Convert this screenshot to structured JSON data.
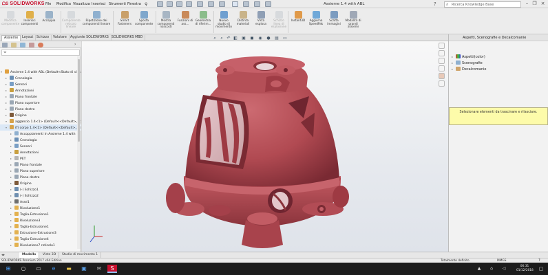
{
  "app": {
    "brand": "SOLIDWORKS",
    "doc_title": "Assieme 1.4 with ABL",
    "search_placeholder": "Ricerca Knowledge Base",
    "menus": [
      "File",
      "Modifica",
      "Visualizza",
      "Inserisci",
      "Strumenti",
      "Finestra"
    ]
  },
  "ribbon": {
    "buttons": [
      {
        "label": "Modifica componente",
        "icon": "edit-component-icon",
        "enabled": false
      },
      {
        "label": "Inserisci componenti",
        "icon": "insert-components-icon",
        "enabled": true
      },
      {
        "label": "Accoppia",
        "icon": "mate-icon",
        "enabled": true
      },
      {
        "label": "Componente reticolo lineare",
        "icon": "linear-pattern-icon",
        "enabled": false
      },
      {
        "label": "Ripetizione dei componenti lineare",
        "icon": "pattern-driven-icon",
        "enabled": true
      },
      {
        "label": "Smart Fasteners",
        "icon": "smart-fasteners-icon",
        "enabled": true
      },
      {
        "label": "Sposta componente",
        "icon": "move-component-icon",
        "enabled": true
      },
      {
        "label": "Mostra componenti nascosti",
        "icon": "show-hidden-icon",
        "enabled": true
      },
      {
        "label": "Funzioni di ass...",
        "icon": "assembly-features-icon",
        "enabled": true
      },
      {
        "label": "Geometria di riferim...",
        "icon": "reference-geometry-icon",
        "enabled": true
      },
      {
        "label": "Nuovo studio di movimento",
        "icon": "motion-study-icon",
        "enabled": true
      },
      {
        "label": "Distinta materiali",
        "icon": "bom-icon",
        "enabled": true
      },
      {
        "label": "Vista esplosa",
        "icon": "exploded-view-icon",
        "enabled": true
      },
      {
        "label": "Schizzo linea di esplosione",
        "icon": "explode-line-icon",
        "enabled": false
      },
      {
        "label": "Instant3D",
        "icon": "instant3d-icon",
        "enabled": true
      },
      {
        "label": "Aggiorna SpeedPak",
        "icon": "speedpak-icon",
        "enabled": true
      },
      {
        "label": "Scatta immagini",
        "icon": "snapshot-icon",
        "enabled": true
      },
      {
        "label": "Modalità di grandi assiemi",
        "icon": "large-assembly-icon",
        "enabled": true
      }
    ]
  },
  "command_tabs": [
    "Assieme",
    "Layout",
    "Schizzo",
    "Valutare",
    "Aggiunte SOLIDWORKS",
    "SOLIDWORKS MBD"
  ],
  "active_command_tab": "Assieme",
  "tree": [
    {
      "label": "Assieme 1.4 with ABL  (Default<Stato di visua",
      "level": 0,
      "icon": "assembly-icon",
      "hl": false
    },
    {
      "label": "Cronologia",
      "level": 1,
      "icon": "history-icon",
      "hl": false
    },
    {
      "label": "Sensori",
      "level": 1,
      "icon": "sensor-icon",
      "hl": false
    },
    {
      "label": "Annotazioni",
      "level": 1,
      "icon": "annotation-icon",
      "hl": false
    },
    {
      "label": "Piano frontale",
      "level": 1,
      "icon": "plane-icon",
      "hl": false
    },
    {
      "label": "Piano superiore",
      "level": 1,
      "icon": "plane-icon",
      "hl": false
    },
    {
      "label": "Piano destro",
      "level": 1,
      "icon": "plane-icon",
      "hl": false
    },
    {
      "label": "Origine",
      "level": 1,
      "icon": "origin-icon",
      "hl": false
    },
    {
      "label": "aggancio 1.4<1> (Default<<Default>_Sta",
      "level": 1,
      "icon": "part-icon",
      "hl": false
    },
    {
      "label": "(f) corpo 1.4<1> (Default<<Default>_Sta",
      "level": 1,
      "icon": "part-icon",
      "hl": true
    },
    {
      "label": "Accoppiamenti in Assieme 1.4 with",
      "level": 2,
      "icon": "mate-folder-icon",
      "hl": false
    },
    {
      "label": "Cronologia",
      "level": 2,
      "icon": "history-icon",
      "hl": false
    },
    {
      "label": "Sensori",
      "level": 2,
      "icon": "sensor-icon",
      "hl": false
    },
    {
      "label": "Annotazioni",
      "level": 2,
      "icon": "annotation-icon",
      "hl": false
    },
    {
      "label": "PET",
      "level": 2,
      "icon": "material-icon",
      "hl": false
    },
    {
      "label": "Piano frontale",
      "level": 2,
      "icon": "plane-icon",
      "hl": false
    },
    {
      "label": "Piano superiore",
      "level": 2,
      "icon": "plane-icon",
      "hl": false
    },
    {
      "label": "Piano destro",
      "level": 2,
      "icon": "plane-icon",
      "hl": false
    },
    {
      "label": "Origine",
      "level": 2,
      "icon": "origin-icon",
      "hl": false
    },
    {
      "label": "(-) Schizzo1",
      "level": 2,
      "icon": "sketch-icon",
      "hl": false
    },
    {
      "label": "(-) Schizzo2",
      "level": 2,
      "icon": "sketch-icon",
      "hl": false
    },
    {
      "label": "Asse1",
      "level": 2,
      "icon": "axis-icon",
      "hl": false
    },
    {
      "label": "Rivoluzione1",
      "level": 2,
      "icon": "feature-icon",
      "hl": false
    },
    {
      "label": "Taglia-Estrusione1",
      "level": 2,
      "icon": "feature-icon",
      "hl": false
    },
    {
      "label": "Rivoluzione3",
      "level": 2,
      "icon": "feature-icon",
      "hl": false
    },
    {
      "label": "Taglia-Estrusione1",
      "level": 2,
      "icon": "feature-icon",
      "hl": false
    },
    {
      "label": "Estrusione-Estrusione3",
      "level": 2,
      "icon": "feature-icon",
      "hl": false
    },
    {
      "label": "Taglia-Estrusione4",
      "level": 2,
      "icon": "feature-icon",
      "hl": false
    },
    {
      "label": "Rivoluzione7 reticolo1",
      "level": 2,
      "icon": "feature-icon",
      "hl": false
    }
  ],
  "bottom_tabs": [
    "Modello",
    "Viste 3D",
    "Studio di movimento 1"
  ],
  "active_bottom_tab": "Modello",
  "right_panel": {
    "title": "Aspetti, Scenografie e Decalcomanie",
    "items": [
      "Aspetti(color)",
      "Scenografie",
      "Decalcomanie"
    ],
    "tip": "Selezionare elementi da trascinare e rilasciare."
  },
  "status": {
    "left": "SOLIDWORKS Premium 2017 x64 Edition",
    "middle": "Totalmente definito",
    "right": "MMGS"
  },
  "taskbar": {
    "time": "06:31",
    "date": "01/12/2018"
  },
  "colors": {
    "model": "#b14a52",
    "model_dark": "#7a2a33",
    "accent": "#c8102e",
    "tip_bg": "#fdfbaa"
  }
}
